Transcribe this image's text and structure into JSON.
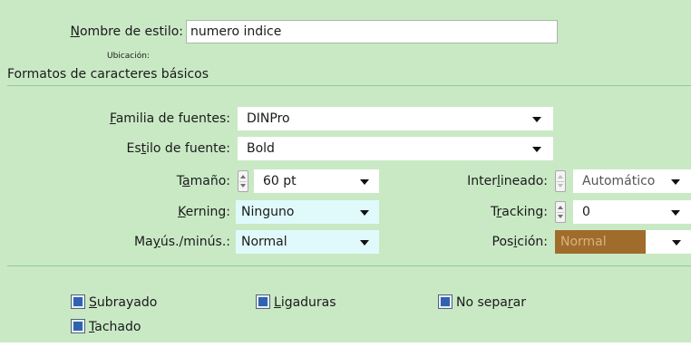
{
  "style_name": {
    "label_pre": "",
    "label_key": "N",
    "label_post": "ombre de estilo:",
    "value": "numero indice"
  },
  "location_label": "Ubicación:",
  "section_title": "Formatos de caracteres básicos",
  "font_family": {
    "label_key": "F",
    "label_post": "amilia de fuentes:",
    "value": "DINPro"
  },
  "font_style": {
    "label_pre": "Es",
    "label_key": "t",
    "label_post": "ilo de fuente:",
    "value": "Bold"
  },
  "size": {
    "label_pre": "T",
    "label_key": "a",
    "label_post": "maño:",
    "value": "60 pt"
  },
  "leading": {
    "label_pre": "Inter",
    "label_key": "l",
    "label_post": "ineado:",
    "value": "Automático"
  },
  "kerning": {
    "label_key": "K",
    "label_post": "erning:",
    "value": "Ninguno"
  },
  "tracking": {
    "label_pre": "T",
    "label_key": "r",
    "label_post": "acking:",
    "value": "0"
  },
  "case": {
    "label_pre": "Ma",
    "label_key": "y",
    "label_post": "ús./minús.:",
    "value": "Normal"
  },
  "position": {
    "label_pre": "Pos",
    "label_key": "i",
    "label_post": "ción:",
    "value": "Normal"
  },
  "checkboxes": {
    "underline": {
      "label_key": "S",
      "label_post": "ubrayado"
    },
    "ligatures": {
      "label_key": "L",
      "label_post": "igaduras"
    },
    "no_break": {
      "label_pre": "No sepa",
      "label_key": "r",
      "label_post": "ar"
    },
    "strikethrough": {
      "label_key": "T",
      "label_post": "achado"
    }
  },
  "colors": {
    "panel_bg": "#c9e9c5",
    "separator": "#8fcf8f",
    "position_field": "#a06c2c",
    "checkbox_fill": "#2f62b3"
  }
}
